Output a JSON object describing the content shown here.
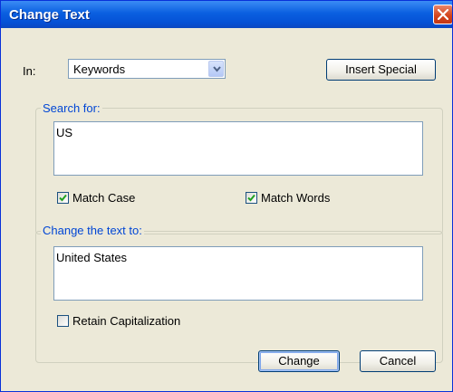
{
  "window": {
    "title": "Change Text"
  },
  "in_field": {
    "label": "In:",
    "value": "Keywords"
  },
  "insert_special_label": "Insert Special",
  "search_group": {
    "legend": "Search for:",
    "text": "US",
    "match_case": {
      "label": "Match Case",
      "checked": true
    },
    "match_words": {
      "label": "Match Words",
      "checked": true
    }
  },
  "change_group": {
    "legend": "Change the text to:",
    "text": "United States",
    "retain_capitalization": {
      "label": "Retain Capitalization",
      "checked": false
    }
  },
  "buttons": {
    "change": "Change",
    "cancel": "Cancel"
  },
  "icons": {
    "close": "close-icon",
    "dropdown": "chevron-down-icon",
    "check": "checkmark-icon"
  },
  "colors": {
    "title_bar": "#0a5fe0",
    "dialog_bg": "#ece9d8",
    "legend_text": "#0046d5",
    "check_mark": "#21a121",
    "close_button": "#d4471f"
  }
}
